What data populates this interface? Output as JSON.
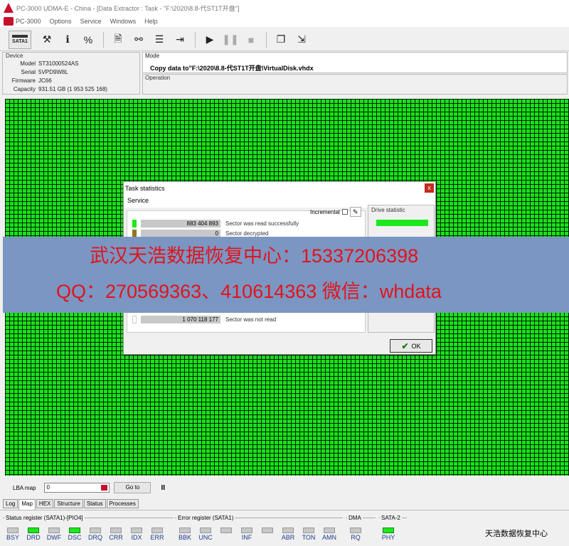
{
  "window": {
    "title": "PC-3000 UDMA-E - China - [Data Extractor : Task - \"F:\\2020\\8.8-代ST1T开盘\"]"
  },
  "menu": [
    "PC-3000",
    "Options",
    "Service",
    "Windows",
    "Help"
  ],
  "toolbar": {
    "sata_label": "SATA1",
    "icons": [
      "tools-icon",
      "info-icon",
      "percent-icon",
      "file-icon",
      "binoculars-icon",
      "stack-icon",
      "export-icon",
      "play-icon",
      "pause-icon",
      "stop-icon",
      "copy-icon",
      "exit-icon"
    ]
  },
  "device": {
    "caption": "Device",
    "model_label": "Model",
    "model": "ST31000524AS",
    "serial_label": "Serial",
    "serial": "5VPD9W8L",
    "firmware_label": "Firmware",
    "firmware": "JC66",
    "capacity_label": "Capacity",
    "capacity": "931.51 GB (1 953 525 168)"
  },
  "mode": {
    "caption": "Mode",
    "value": "Copy data to\"F:\\2020\\8.8-代ST1T开盘\\VirtualDisk.vhdx"
  },
  "operation": {
    "caption": "Operation"
  },
  "dialog": {
    "title": "Task statistics",
    "close": "x",
    "service_label": "Service",
    "incremental_label": "Incremental",
    "rows": [
      {
        "count": "883 404 893",
        "label": "Sector was read successfully",
        "color": "#1de81d"
      },
      {
        "count": "0",
        "label": "Sector decrypted",
        "color": "#8a7a1a"
      },
      {
        "count": "1 070 118 177",
        "label": "Sector was not read",
        "color": "#ffffff"
      }
    ],
    "drive_statistic_label": "Drive statistic",
    "ok_label": "OK"
  },
  "banner": {
    "line1": "武汉天浩数据恢复中心：15337206398",
    "line2": "QQ：270569363、410614363   微信：whdata"
  },
  "lba": {
    "label": "LBA map",
    "value": "0",
    "goto_label": "Go to",
    "pause_symbol": "II"
  },
  "tabs": [
    "Log",
    "Map",
    "HEX",
    "Structure",
    "Status",
    "Processes"
  ],
  "active_tab": "Map",
  "registers": {
    "status_caption": "Status register (SATA1)-[PIO4]",
    "status": [
      {
        "name": "BSY",
        "on": false
      },
      {
        "name": "DRD",
        "on": true
      },
      {
        "name": "DWF",
        "on": false
      },
      {
        "name": "DSC",
        "on": true
      },
      {
        "name": "DRQ",
        "on": false
      },
      {
        "name": "CRR",
        "on": false
      },
      {
        "name": "IDX",
        "on": false
      },
      {
        "name": "ERR",
        "on": false
      }
    ],
    "error_caption": "Error register (SATA1)",
    "error": [
      {
        "name": "BBK",
        "on": false
      },
      {
        "name": "UNC",
        "on": false
      },
      {
        "name": "",
        "on": false
      },
      {
        "name": "INF",
        "on": false
      },
      {
        "name": "",
        "on": false
      },
      {
        "name": "ABR",
        "on": false
      },
      {
        "name": "TON",
        "on": false
      },
      {
        "name": "AMN",
        "on": false
      }
    ],
    "dma_caption": "DMA",
    "dma": [
      {
        "name": "RQ",
        "on": false
      }
    ],
    "sata2_caption": "SATA-2",
    "sata2": [
      {
        "name": "PHY",
        "on": true
      }
    ]
  },
  "watermark": "天浩数据恢复中心"
}
